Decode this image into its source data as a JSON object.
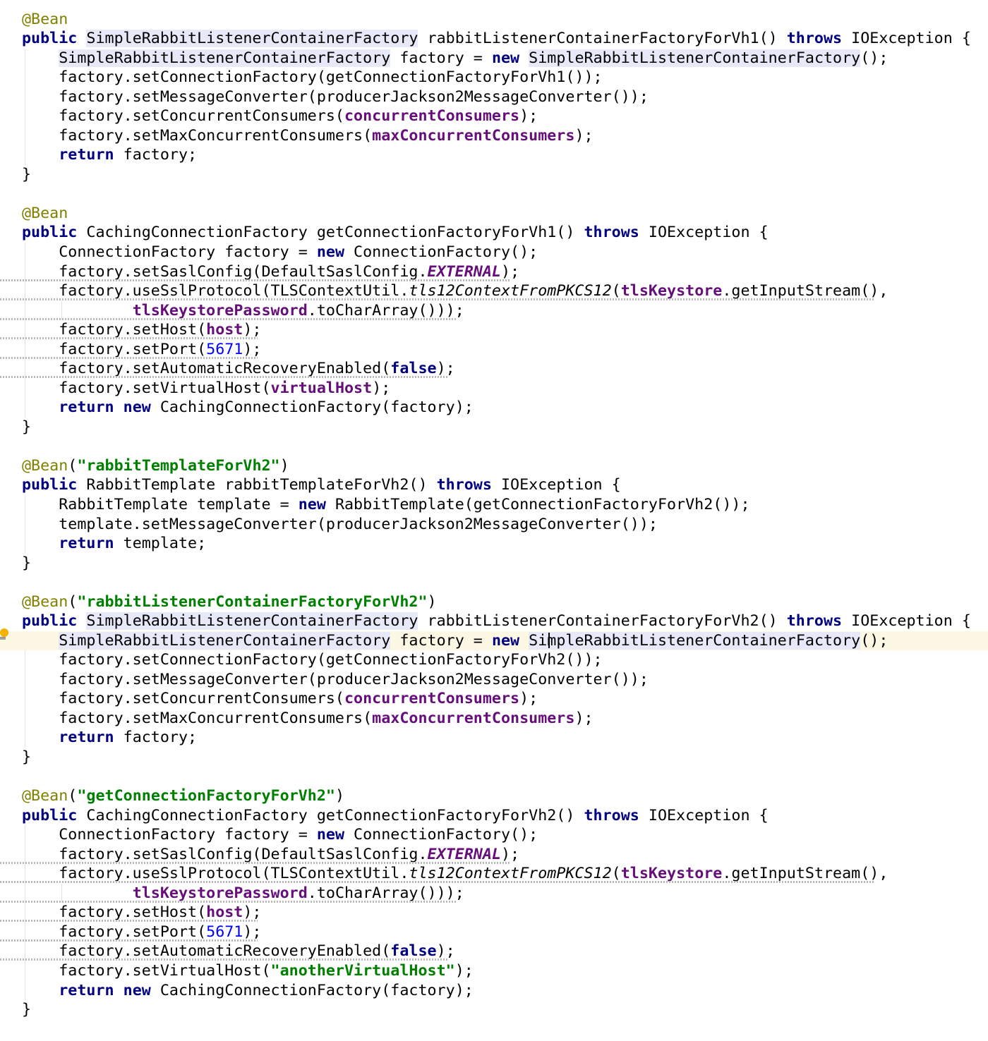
{
  "editor": {
    "lines": [
      {
        "t": [
          [
            "@Bean",
            "ann"
          ]
        ]
      },
      {
        "t": [
          [
            "public",
            "kw"
          ],
          [
            " "
          ],
          [
            "SimpleRabbitListenerContainerFactory",
            "hl"
          ],
          [
            " rabbitListenerContainerFactoryForVh1() "
          ],
          [
            "throws",
            "kw"
          ],
          [
            " IOException {"
          ]
        ]
      },
      {
        "t": [
          [
            "    "
          ],
          [
            "SimpleRabbitListenerContainerFactory",
            "hl"
          ],
          [
            " factory = "
          ],
          [
            "new",
            "kw"
          ],
          [
            " "
          ],
          [
            "SimpleRabbitListenerContainerFactory",
            "hl"
          ],
          [
            "();"
          ]
        ]
      },
      {
        "t": [
          [
            "    factory.setConnectionFactory(getConnectionFactoryForVh1());"
          ]
        ]
      },
      {
        "t": [
          [
            "    factory.setMessageConverter(producerJackson2MessageConverter());"
          ]
        ]
      },
      {
        "t": [
          [
            "    factory.setConcurrentConsumers("
          ],
          [
            "concurrentConsumers",
            "fld"
          ],
          [
            ");"
          ]
        ]
      },
      {
        "t": [
          [
            "    factory.setMaxConcurrentConsumers("
          ],
          [
            "maxConcurrentConsumers",
            "fld"
          ],
          [
            ");"
          ]
        ]
      },
      {
        "t": [
          [
            "    "
          ],
          [
            "return",
            "kw"
          ],
          [
            " factory;"
          ]
        ]
      },
      {
        "t": [
          [
            "}"
          ]
        ]
      },
      {
        "t": []
      },
      {
        "t": [
          [
            "@Bean",
            "ann"
          ]
        ]
      },
      {
        "t": [
          [
            "public",
            "kw"
          ],
          [
            " CachingConnectionFactory getConnectionFactoryForVh1() "
          ],
          [
            "throws",
            "kw"
          ],
          [
            " IOException {"
          ]
        ]
      },
      {
        "t": [
          [
            "    ConnectionFactory factory = "
          ],
          [
            "new",
            "kw"
          ],
          [
            " ConnectionFactory();"
          ]
        ]
      },
      {
        "t": [
          [
            "    factory.setSaslConfig(DefaultSaslConfig."
          ],
          [
            "EXTERNAL",
            "sfld"
          ],
          [
            ");"
          ]
        ]
      },
      {
        "t": [
          [
            "    factory.useSslProtocol(TLSContextUtil."
          ],
          [
            "tls12ContextFromPKCS12",
            "it"
          ],
          [
            "("
          ],
          [
            "tlsKeystore",
            "fld"
          ],
          [
            ".getInputStream(),"
          ]
        ]
      },
      {
        "t": [
          [
            "            "
          ],
          [
            "tlsKeystorePassword",
            "fld"
          ],
          [
            ".toCharArray()));"
          ]
        ]
      },
      {
        "t": [
          [
            "    factory.setHost("
          ],
          [
            "host",
            "fld"
          ],
          [
            ");"
          ]
        ]
      },
      {
        "t": [
          [
            "    factory.setPort("
          ],
          [
            "5671",
            "num"
          ],
          [
            ");"
          ]
        ]
      },
      {
        "t": [
          [
            "    factory.setAutomaticRecoveryEnabled("
          ],
          [
            "false",
            "kw"
          ],
          [
            ");"
          ]
        ]
      },
      {
        "t": [
          [
            "    factory.setVirtualHost("
          ],
          [
            "virtualHost",
            "fld"
          ],
          [
            ");"
          ]
        ]
      },
      {
        "t": [
          [
            "    "
          ],
          [
            "return",
            "kw"
          ],
          [
            " "
          ],
          [
            "new",
            "kw"
          ],
          [
            " CachingConnectionFactory(factory);"
          ]
        ]
      },
      {
        "t": [
          [
            "}"
          ]
        ]
      },
      {
        "t": []
      },
      {
        "t": [
          [
            "@Bean",
            "ann"
          ],
          [
            "("
          ],
          [
            "\"rabbitTemplateForVh2\"",
            "str"
          ],
          [
            ")"
          ]
        ]
      },
      {
        "t": [
          [
            "public",
            "kw"
          ],
          [
            " RabbitTemplate rabbitTemplateForVh2() "
          ],
          [
            "throws",
            "kw"
          ],
          [
            " IOException {"
          ]
        ]
      },
      {
        "t": [
          [
            "    RabbitTemplate template = "
          ],
          [
            "new",
            "kw"
          ],
          [
            " RabbitTemplate(getConnectionFactoryForVh2());"
          ]
        ]
      },
      {
        "t": [
          [
            "    template.setMessageConverter(producerJackson2MessageConverter());"
          ]
        ]
      },
      {
        "t": [
          [
            "    "
          ],
          [
            "return",
            "kw"
          ],
          [
            " template;"
          ]
        ]
      },
      {
        "t": [
          [
            "}"
          ]
        ]
      },
      {
        "t": []
      },
      {
        "t": [
          [
            "@Bean",
            "ann"
          ],
          [
            "("
          ],
          [
            "\"rabbitListenerContainerFactoryForVh2\"",
            "str"
          ],
          [
            ")"
          ]
        ]
      },
      {
        "t": [
          [
            "public",
            "kw"
          ],
          [
            " "
          ],
          [
            "SimpleRabbitListenerContainerFactory",
            "hl"
          ],
          [
            " rabbitListenerContainerFactoryForVh2() "
          ],
          [
            "throws",
            "kw"
          ],
          [
            " IOException {"
          ]
        ]
      },
      {
        "t": [
          [
            "    "
          ],
          [
            "SimpleRabbitListenerContainerFactory",
            "hl"
          ],
          [
            " factory = "
          ],
          [
            "new",
            "kw"
          ],
          [
            " "
          ],
          [
            "SimpleRabbitListenerContainerFactory",
            "hl"
          ],
          [
            "();"
          ]
        ]
      },
      {
        "t": [
          [
            "    factory.setConnectionFactory(getConnectionFactoryForVh2());"
          ]
        ]
      },
      {
        "t": [
          [
            "    factory.setMessageConverter(producerJackson2MessageConverter());"
          ]
        ]
      },
      {
        "t": [
          [
            "    factory.setConcurrentConsumers("
          ],
          [
            "concurrentConsumers",
            "fld"
          ],
          [
            ");"
          ]
        ]
      },
      {
        "t": [
          [
            "    factory.setMaxConcurrentConsumers("
          ],
          [
            "maxConcurrentConsumers",
            "fld"
          ],
          [
            ");"
          ]
        ]
      },
      {
        "t": [
          [
            "    "
          ],
          [
            "return",
            "kw"
          ],
          [
            " factory;"
          ]
        ]
      },
      {
        "t": [
          [
            "}"
          ]
        ]
      },
      {
        "t": []
      },
      {
        "t": [
          [
            "@Bean",
            "ann"
          ],
          [
            "("
          ],
          [
            "\"getConnectionFactoryForVh2\"",
            "str"
          ],
          [
            ")"
          ]
        ]
      },
      {
        "t": [
          [
            "public",
            "kw"
          ],
          [
            " CachingConnectionFactory getConnectionFactoryForVh2() "
          ],
          [
            "throws",
            "kw"
          ],
          [
            " IOException {"
          ]
        ]
      },
      {
        "t": [
          [
            "    ConnectionFactory factory = "
          ],
          [
            "new",
            "kw"
          ],
          [
            " ConnectionFactory();"
          ]
        ]
      },
      {
        "t": [
          [
            "    factory.setSaslConfig(DefaultSaslConfig."
          ],
          [
            "EXTERNAL",
            "sfld"
          ],
          [
            ");"
          ]
        ]
      },
      {
        "t": [
          [
            "    factory.useSslProtocol(TLSContextUtil."
          ],
          [
            "tls12ContextFromPKCS12",
            "it"
          ],
          [
            "("
          ],
          [
            "tlsKeystore",
            "fld"
          ],
          [
            ".getInputStream(),"
          ]
        ]
      },
      {
        "t": [
          [
            "            "
          ],
          [
            "tlsKeystorePassword",
            "fld"
          ],
          [
            ".toCharArray()));"
          ]
        ]
      },
      {
        "t": [
          [
            "    factory.setHost("
          ],
          [
            "host",
            "fld"
          ],
          [
            ");"
          ]
        ]
      },
      {
        "t": [
          [
            "    factory.setPort("
          ],
          [
            "5671",
            "num"
          ],
          [
            ");"
          ]
        ]
      },
      {
        "t": [
          [
            "    factory.setAutomaticRecoveryEnabled("
          ],
          [
            "false",
            "kw"
          ],
          [
            ");"
          ]
        ]
      },
      {
        "t": [
          [
            "    factory.setVirtualHost("
          ],
          [
            "\"anotherVirtualHost\"",
            "str"
          ],
          [
            ");"
          ]
        ]
      },
      {
        "t": [
          [
            "    "
          ],
          [
            "return",
            "kw"
          ],
          [
            " "
          ],
          [
            "new",
            "kw"
          ],
          [
            " CachingConnectionFactory(factory);"
          ]
        ]
      },
      {
        "t": [
          [
            "}"
          ]
        ]
      }
    ],
    "caret_line": 32,
    "squiggle_lines": [
      13,
      14,
      15,
      16,
      17,
      18,
      43,
      44,
      45,
      46,
      47,
      48
    ],
    "squiggle_widths": {
      "13": 724,
      "14": 1238,
      "15": 648,
      "16": 365,
      "17": 365,
      "18": 634,
      "43": 724,
      "44": 1238,
      "45": 648,
      "46": 365,
      "47": 365,
      "48": 634
    },
    "gutter_icon": "lightbulb-icon",
    "colors": {
      "keyword": "#000080",
      "annotation": "#808000",
      "string": "#008000",
      "field": "#660e7a",
      "number": "#0000ff",
      "highlight": "#e8e9f8",
      "caret_row": "#fdf8e4"
    }
  }
}
